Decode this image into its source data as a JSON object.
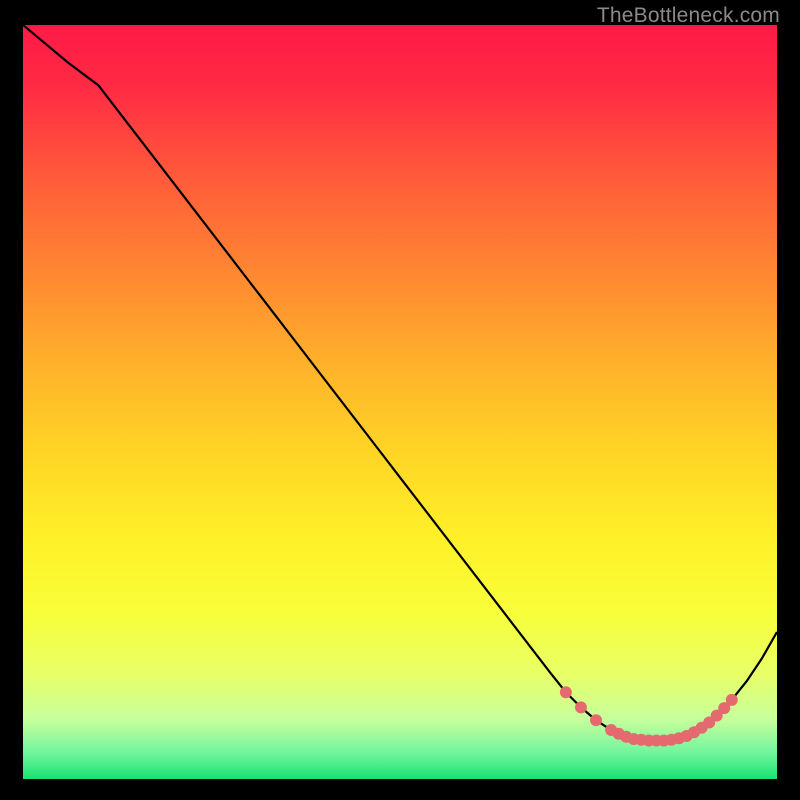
{
  "watermark": "TheBottleneck.com",
  "chart_data": {
    "type": "line",
    "title": "",
    "xlabel": "",
    "ylabel": "",
    "xlim": [
      0,
      100
    ],
    "ylim": [
      0,
      100
    ],
    "x": [
      0,
      6,
      10,
      20,
      30,
      40,
      50,
      60,
      70,
      72,
      74,
      76,
      78,
      80,
      82,
      84,
      86,
      88,
      90,
      92,
      94,
      96,
      98,
      100
    ],
    "values": [
      100,
      95,
      92,
      79,
      66,
      53,
      40,
      27,
      14,
      11.5,
      9.5,
      7.8,
      6.5,
      5.6,
      5.2,
      5.1,
      5.2,
      5.7,
      6.8,
      8.4,
      10.5,
      13,
      16,
      19.5
    ],
    "marker_x": [
      72,
      74,
      76,
      78,
      79,
      80,
      81,
      82,
      83,
      84,
      85,
      86,
      87,
      88,
      89,
      90,
      91,
      92,
      93,
      94
    ],
    "marker_y": [
      11.5,
      9.5,
      7.8,
      6.5,
      6.0,
      5.6,
      5.3,
      5.2,
      5.1,
      5.1,
      5.1,
      5.2,
      5.4,
      5.7,
      6.2,
      6.8,
      7.5,
      8.4,
      9.4,
      10.5
    ],
    "gradient_stops": [
      {
        "offset": 0.0,
        "color": "#ff1a46"
      },
      {
        "offset": 0.08,
        "color": "#ff2a44"
      },
      {
        "offset": 0.2,
        "color": "#ff5a3a"
      },
      {
        "offset": 0.32,
        "color": "#ff8432"
      },
      {
        "offset": 0.44,
        "color": "#ffae2b"
      },
      {
        "offset": 0.56,
        "color": "#ffd326"
      },
      {
        "offset": 0.68,
        "color": "#fff028"
      },
      {
        "offset": 0.78,
        "color": "#f7ff3a"
      },
      {
        "offset": 0.86,
        "color": "#e8ff66"
      },
      {
        "offset": 0.92,
        "color": "#c8ff9c"
      },
      {
        "offset": 0.965,
        "color": "#72f59e"
      },
      {
        "offset": 1.0,
        "color": "#18e26f"
      }
    ],
    "marker_color": "#e46a6f",
    "line_color": "#000000"
  }
}
